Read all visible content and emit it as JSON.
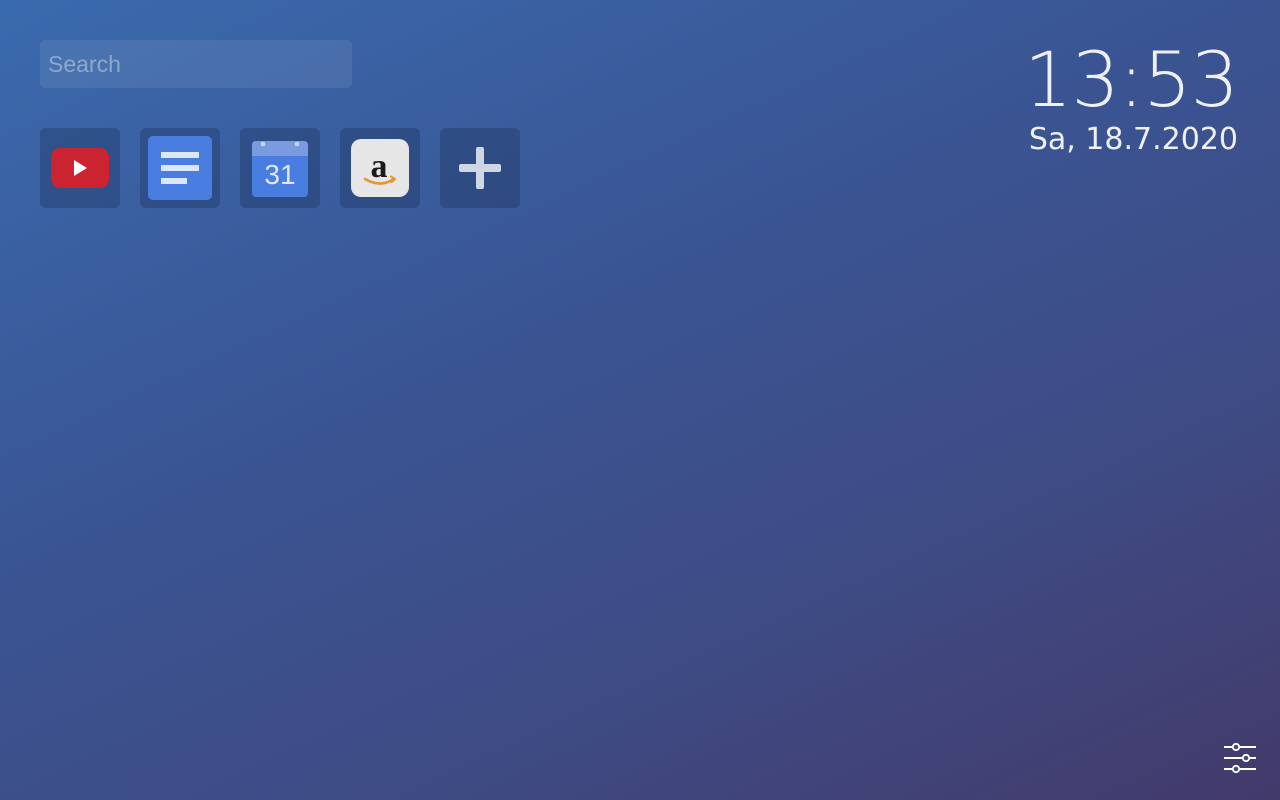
{
  "search": {
    "placeholder": "Search",
    "value": ""
  },
  "shortcuts": [
    {
      "name": "YouTube",
      "icon": "youtube-icon",
      "color": "#cc2330"
    },
    {
      "name": "Google Docs",
      "icon": "google-docs-icon",
      "color": "#4a7de0"
    },
    {
      "name": "Google Calendar",
      "icon": "google-calendar-icon",
      "color": "#4a7de0",
      "icon_text": "31"
    },
    {
      "name": "Amazon",
      "icon": "amazon-icon",
      "color": "#e6e6e6",
      "icon_text": "a"
    },
    {
      "name": "Add shortcut",
      "icon": "plus-icon"
    }
  ],
  "clock": {
    "time": "13:53",
    "date": "Sa, 18.7.2020"
  },
  "settings": {
    "icon": "sliders-icon"
  }
}
